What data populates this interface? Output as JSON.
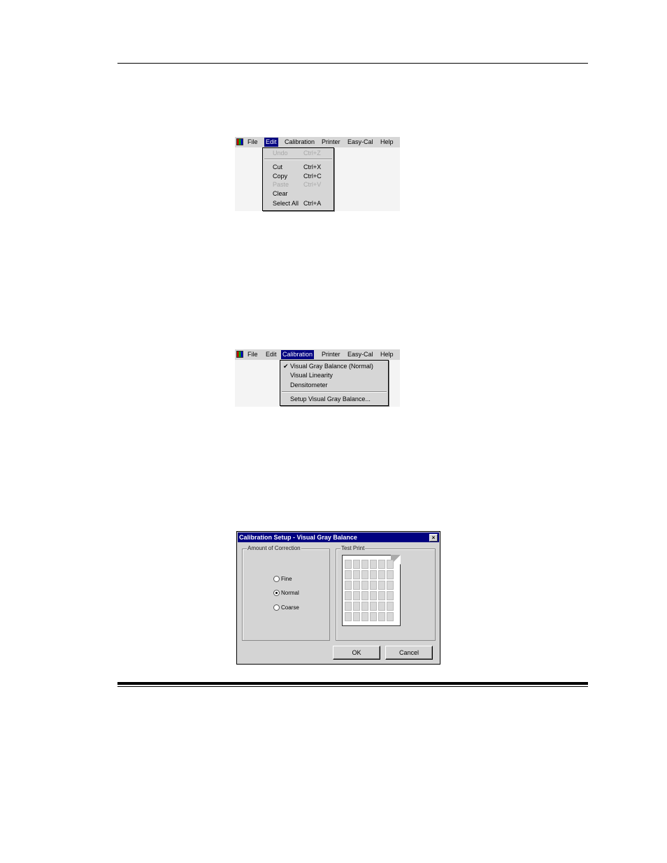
{
  "screenshot1": {
    "menubar": [
      "File",
      "Edit",
      "Calibration",
      "Printer",
      "Easy-Cal",
      "Help"
    ],
    "active_menu": "Edit",
    "edit_menu": [
      {
        "label": "Undo",
        "shortcut": "Ctrl+Z",
        "disabled": true
      },
      {
        "label": "Cut",
        "shortcut": "Ctrl+X",
        "disabled": false
      },
      {
        "label": "Copy",
        "shortcut": "Ctrl+C",
        "disabled": false
      },
      {
        "label": "Paste",
        "shortcut": "Ctrl+V",
        "disabled": true
      },
      {
        "label": "Clear",
        "shortcut": "",
        "disabled": false
      },
      {
        "label": "Select All",
        "shortcut": "Ctrl+A",
        "disabled": false
      }
    ]
  },
  "screenshot2": {
    "menubar": [
      "File",
      "Edit",
      "Calibration",
      "Printer",
      "Easy-Cal",
      "Help"
    ],
    "active_menu": "Calibration",
    "calibration_menu": [
      {
        "label": "Visual Gray Balance (Normal)",
        "checked": true
      },
      {
        "label": "Visual Linearity",
        "checked": false
      },
      {
        "label": "Densitometer",
        "checked": false
      },
      {
        "label": "Setup Visual Gray Balance...",
        "checked": false
      }
    ]
  },
  "dialog": {
    "title": "Calibration Setup - Visual Gray Balance",
    "close_glyph": "×",
    "correction_group": "Amount of Correction",
    "options": [
      {
        "label": "Fine",
        "selected": false
      },
      {
        "label": "Normal",
        "selected": true
      },
      {
        "label": "Coarse",
        "selected": false
      }
    ],
    "test_print_group": "Test Print",
    "ok_label": "OK",
    "cancel_label": "Cancel"
  }
}
